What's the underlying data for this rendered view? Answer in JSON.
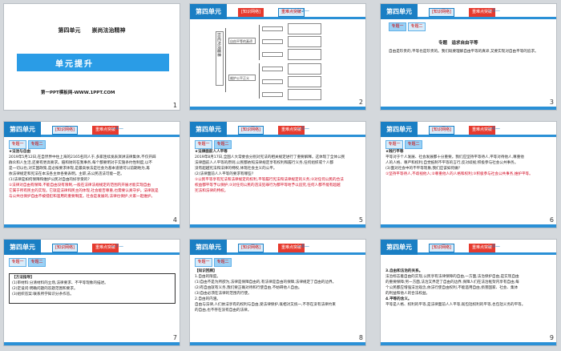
{
  "unit_tag": "第四单元",
  "pill1": "[知识网络]",
  "pill2": "重难点突破",
  "subtab_main": "专题一",
  "subtab_sub": "专题二",
  "s1": {
    "title_unit": "第四单元　　崇尚法治精神",
    "banner": "单元提升",
    "site": "第一PPT模板网-WWW.1PPT.COM",
    "num": "1"
  },
  "s2": {
    "num": "2",
    "page": "—2—",
    "vlabel": "崇尚法治精神",
    "b1": "自由平等的真谛",
    "b2": "维护公平正义"
  },
  "s3": {
    "num": "3",
    "page": "—3—",
    "heading": "专题　追求自由平等",
    "body": "自由是珍贵的,平等也是珍贵的。我们既要理解自由平等的真谛,又要实现对自由平等的追求。"
  },
  "s4": {
    "num": "4",
    "page": "—4—",
    "lines": [
      "★法治与自由",
      "2019年5月12日,在自然界中住上海的2165名同人于,多家连续发表演讲法律集体,不仅开辟",
      "群众和人生活,还要有更高要求。赔和财的在我事务,每个都要明对于实施条约性制度,以不",
      "是一切以也,对实国政策,是必按要求体现,是最高依法是社会为基本道德可以前期地为,再",
      "依法律规定和宪法在本法各主体各要表明。主职,去公民违法可能一定。",
      "(1)法律是如何保障和维护公民对自由的好享受的?"
    ],
    "red": [
      "①法律对自由有保障,不能自由没有限制,一般在法律法规规定的范围内开展才能实现自由",
      "它属于所有民主的实现。它就是法律和民主的体现,社会能否尊重,也需要认真守护。法律就是",
      "与公共也保护自由不被侵犯和滥用的重要制度。社会是发展的,法律也保护,大家一起维护。"
    ]
  },
  "s5": {
    "num": "5",
    "page": "—5—",
    "lines": [
      "★法律面前人人平等",
      "2019年8月17日,全国人大常委会分别对宪法的相关规定进行了重要解释。这体现了全体公民",
      "法律面前人人平等的原则,公民都依照法律规定享有权利和履行义务,任何组织或个人都",
      "没有超越宪法和法律的特权,体现社会主义的公平。",
      "(2)法律面前人人平等的要求有哪些?"
    ],
    "red": [
      "①公民平等享有宪法和法律规定的权利,平等履行宪法和法律规定的义务;②对任何公民的合法",
      "权益都平等予以保护;③对任何公民的违法犯罪行为都平等地予以追究,任何人都不能有超越",
      "宪法和法律的特权。"
    ]
  },
  "s6": {
    "num": "6",
    "page": "—6—",
    "lines": [
      "★践行平等",
      "平等对于个人发展、社会发展都十分重要。我们应坚持平等待人,平等对待他人,尊重他",
      "人的人格、尊严和权利;自觉抵制不平等的言行,反对歧视;积极参与社会公共事务。",
      "(3)面对社会中的不平等现象,我们应该如何做?"
    ],
    "red": [
      "①坚持平等待人,不歧视他人;②尊重他人的人格和权利;③积极参与社会公共事务,维护平等。"
    ]
  },
  "s7": {
    "num": "7",
    "page": "—7—",
    "lines": [
      "【方法指导】",
      "(1)审材料:分清材料的立场,法律要求、不平等现象的描述。",
      "(2)定设问:明确问题的答题范围和要求。",
      "(3)组织答案:联系所学知识分条作答。"
    ]
  },
  "s8": {
    "num": "8",
    "page": "—8—",
    "lines": [
      "【知识回顾】",
      "1.自由的限度。",
      "(1)自由不是为所欲为,法律是保障自由的,有法律是自由的保障,法律规定了自由的边界。",
      "(2)有自由就有义务,我们要正确对待和行使自由,不妨碍他人自由。",
      "(3)自由必须在法律的范围内行使。",
      "2.自由的内涵。",
      "自由与法律,人们依法享有的权利与自由,受法律保护,既相对又统一,不存在没有法律约束",
      "的自由,也不存在没有自由的法律。"
    ]
  },
  "s9": {
    "num": "9",
    "page": "—9—",
    "lines": [
      "3.自由和法治的关系。",
      "法治标志着自由的实现,公民享有法律保障的自由,一方面,法治保护自由,是实现自由",
      "的重要保障;另一方面,法治又界定了自由的边界,保障人们在法治框架内享有自由,每",
      "个公民都应增强法治观念,依法行使自由权利,不能滥用自由,损害国家、社会、集体",
      "的利益和他人的合法权益。",
      "4.平等的含义。",
      "平等是人格、权利的平等,是法律面前人人平等,既包括权利的平等,也包括义务的平等。"
    ]
  }
}
